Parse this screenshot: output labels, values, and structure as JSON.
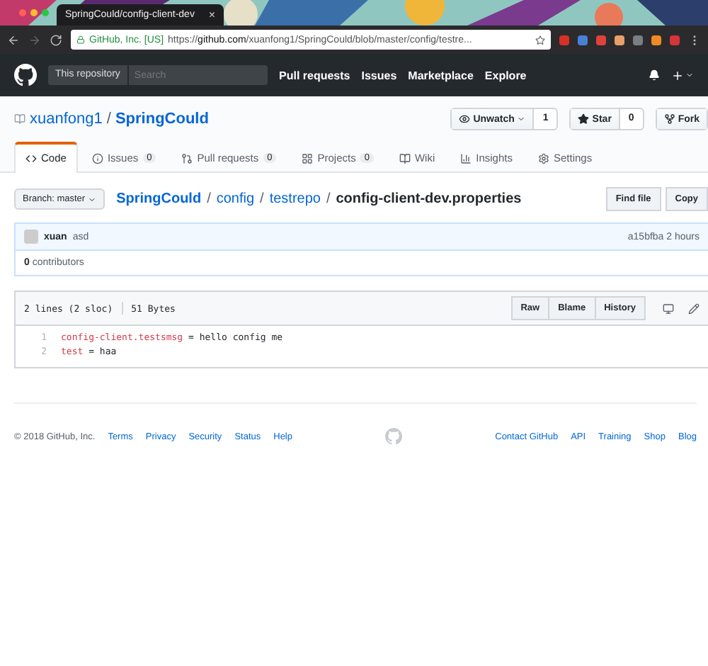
{
  "browser": {
    "tab_title": "SpringCould/config-client-dev",
    "close": "×",
    "secure_label": "GitHub, Inc. [US]",
    "url": "https://**github.com**/xuanfong1/SpringCould/blob/master/config/testre...",
    "extensions": [
      {
        "color": "#d93025"
      },
      {
        "color": "#4a7fd6"
      },
      {
        "color": "#e0413a"
      },
      {
        "color": "#e8a06a"
      },
      {
        "color": "#7a7f86"
      },
      {
        "color": "#f08a24"
      },
      {
        "color": "#d8343a"
      }
    ]
  },
  "header": {
    "scope": "This repository",
    "search_placeholder": "Search",
    "nav": [
      "Pull requests",
      "Issues",
      "Marketplace",
      "Explore"
    ]
  },
  "repo": {
    "owner": "xuanfong1",
    "separator": "/",
    "name": "SpringCould",
    "actions": [
      {
        "label": "Unwatch",
        "count": "1",
        "kind": "watch"
      },
      {
        "label": "Star",
        "count": "0",
        "kind": "star"
      },
      {
        "label": "Fork",
        "kind": "fork"
      }
    ]
  },
  "tabs": [
    {
      "label": "Code",
      "kind": "code",
      "selected": true
    },
    {
      "label": "Issues",
      "count": "0",
      "kind": "issues",
      "selected": false
    },
    {
      "label": "Pull requests",
      "count": "0",
      "kind": "pulls",
      "selected": false
    },
    {
      "label": "Projects",
      "count": "0",
      "kind": "projects",
      "selected": false
    },
    {
      "label": "Wiki",
      "kind": "wiki",
      "selected": false
    },
    {
      "label": "Insights",
      "kind": "insights",
      "selected": false
    },
    {
      "label": "Settings",
      "kind": "settings",
      "selected": false
    }
  ],
  "breadcrumb": {
    "branch": "Branch: master",
    "path": [
      "SpringCould",
      "config",
      "testrepo"
    ],
    "separator": "/",
    "file": "config-client-dev.properties",
    "buttons": [
      "Find file",
      "Copy"
    ]
  },
  "commit": {
    "author": "xuan",
    "message": "asd",
    "sha_time": "a15bfba 2 hours"
  },
  "contributors": {
    "count": "0",
    "label": "contributors"
  },
  "file": {
    "lines_info": "2 lines (2 sloc)",
    "size": "51 Bytes",
    "buttons": [
      "Raw",
      "Blame",
      "History"
    ],
    "lines": [
      {
        "number": "1",
        "key": "config-client.testsmsg",
        "op": "=",
        "value": "hello config me"
      },
      {
        "number": "2",
        "key": "test",
        "op": "=",
        "value": "haa"
      }
    ]
  },
  "footer": {
    "copyright": "© 2018 GitHub, Inc.",
    "left_links": [
      "Terms",
      "Privacy",
      "Security",
      "Status",
      "Help"
    ],
    "right_links": [
      "Contact GitHub",
      "API",
      "Training",
      "Shop",
      "Blog"
    ]
  }
}
